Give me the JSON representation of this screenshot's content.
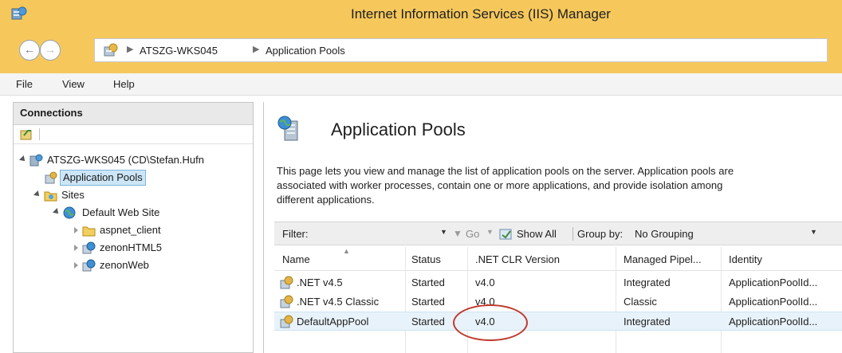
{
  "window": {
    "title": "Internet Information Services (IIS) Manager"
  },
  "address": {
    "crumbs": [
      "ATSZG-WKS045",
      "Application Pools"
    ]
  },
  "menu": {
    "items": [
      "File",
      "View",
      "Help"
    ]
  },
  "connections": {
    "header": "Connections",
    "tree": {
      "server": "ATSZG-WKS045 (CD\\Stefan.Hufn",
      "app_pools": "Application Pools",
      "sites": "Sites",
      "default_site": "Default Web Site",
      "children": [
        "aspnet_client",
        "zenonHTML5",
        "zenonWeb"
      ]
    }
  },
  "main": {
    "title": "Application Pools",
    "description_lines": [
      "This page lets you view and manage the list of application pools on the server. Application pools are",
      "associated with worker processes, contain one or more applications, and provide isolation among",
      "different applications."
    ],
    "filter": {
      "label": "Filter:",
      "go_label": "Go",
      "show_all_label": "Show All",
      "group_by_label": "Group by:",
      "group_by_value": "No Grouping"
    },
    "columns": [
      "Name",
      "Status",
      ".NET CLR Version",
      "Managed Pipel...",
      "Identity"
    ],
    "rows": [
      {
        "name": ".NET v4.5",
        "status": "Started",
        "clr": "v4.0",
        "pipeline": "Integrated",
        "identity": "ApplicationPoolId..."
      },
      {
        "name": ".NET v4.5 Classic",
        "status": "Started",
        "clr": "v4.0",
        "pipeline": "Classic",
        "identity": "ApplicationPoolId..."
      },
      {
        "name": "DefaultAppPool",
        "status": "Started",
        "clr": "v4.0",
        "pipeline": "Integrated",
        "identity": "ApplicationPoolId..."
      }
    ]
  },
  "colors": {
    "titlebar": "#f6c85c",
    "selection": "#cde6f7",
    "highlight_ring": "#c0392b"
  }
}
